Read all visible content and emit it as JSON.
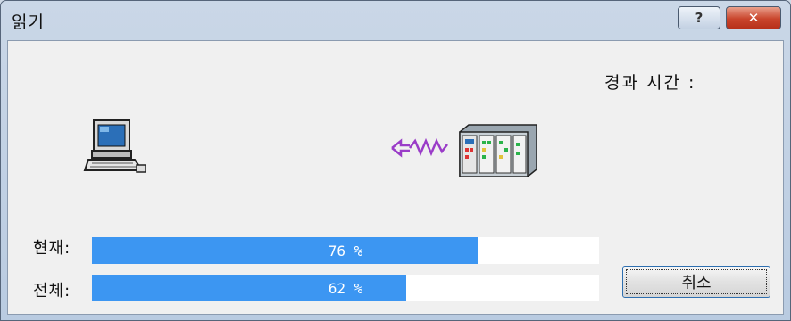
{
  "window": {
    "title": "읽기",
    "help_glyph": "?",
    "close_glyph": "✕"
  },
  "elapsed_label": "경과 시간 :",
  "icons": {
    "source": "computer-icon",
    "target": "plc-icon",
    "link": "transfer-arrow-icon"
  },
  "progress": {
    "current": {
      "label": "현재:",
      "percent": 76,
      "text": "76 %"
    },
    "total": {
      "label": "전체:",
      "percent": 62,
      "text": "62 %"
    }
  },
  "cancel_label": "취소",
  "colors": {
    "progress_fill": "#3c96f2",
    "close_button": "#c9452c"
  }
}
